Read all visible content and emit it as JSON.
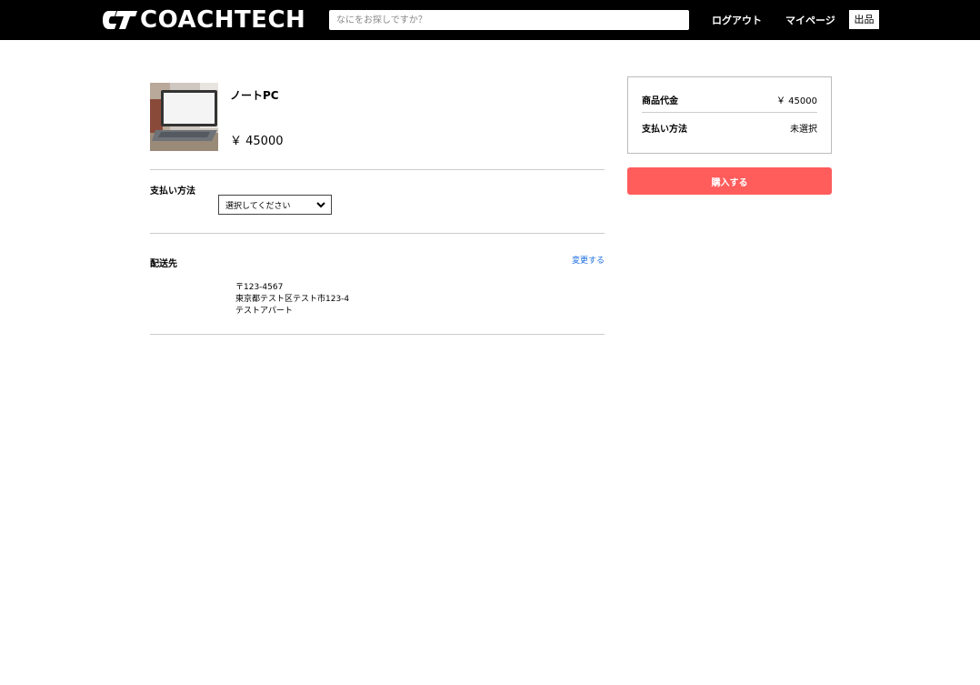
{
  "header": {
    "logo_text": "COACHTECH",
    "search_placeholder": "なにをお探しですか？",
    "logout_label": "ログアウト",
    "mypage_label": "マイページ",
    "sell_label": "出品"
  },
  "item": {
    "name": "ノートPC",
    "price": "￥ 45000"
  },
  "payment": {
    "label": "支払い方法",
    "select_value": "選択してください"
  },
  "shipping": {
    "label": "配送先",
    "change_label": "変更する",
    "postal": "〒123-4567",
    "address": "東京都テスト区テスト市123-4",
    "building": "テストアパート"
  },
  "summary": {
    "price_label": "商品代金",
    "price_value": "￥ 45000",
    "payment_label": "支払い方法",
    "payment_value": "未選択"
  },
  "purchase_button": "購入する",
  "colors": {
    "header_bg": "#000000",
    "buy_button": "#ff5c5c",
    "link": "#1a6ee0"
  }
}
